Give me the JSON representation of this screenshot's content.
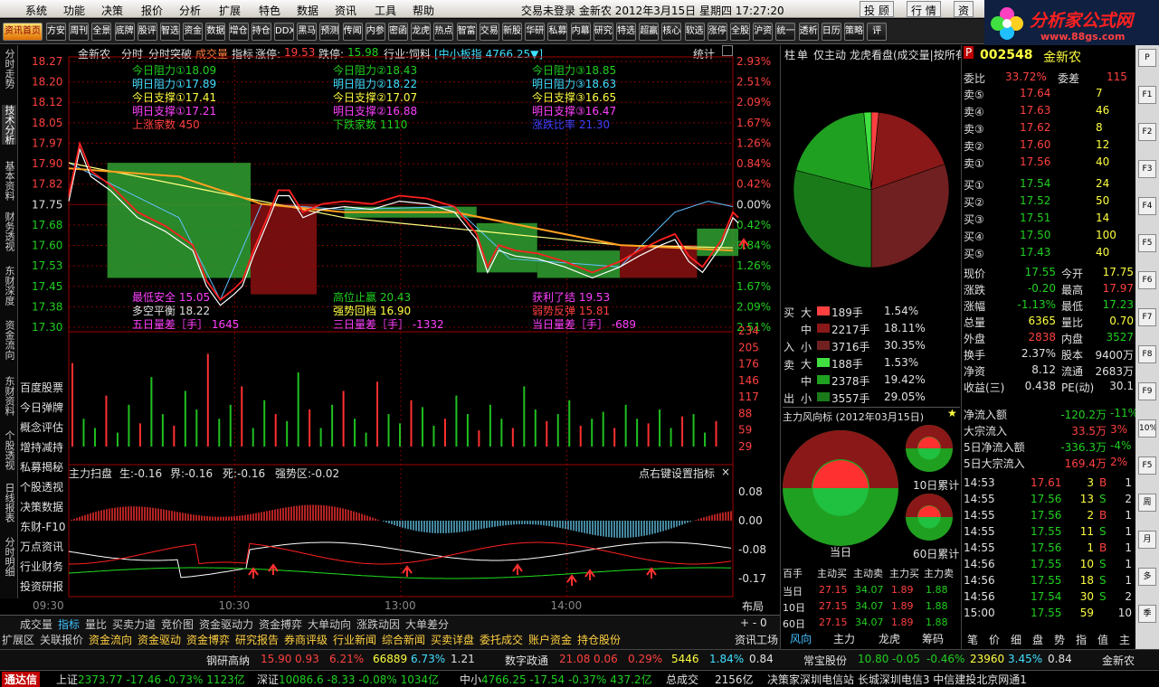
{
  "menu": {
    "items": [
      "系统",
      "功能",
      "决策",
      "报价",
      "分析",
      "扩展",
      "特色",
      "数据",
      "资讯",
      "工具",
      "帮助"
    ],
    "status": "交易未登录",
    "stock_name": "金新农",
    "datetime": "2012年3月15日 星期四 17:27:20",
    "right_buttons": [
      "投 顾",
      "行 情",
      "资"
    ]
  },
  "logo": {
    "title": "分析家公式网",
    "url": "www.88gs.com"
  },
  "toolbar": [
    "资讯首页",
    "方安",
    "周刊",
    "全景",
    "底牌",
    "股评",
    "智选",
    "资金",
    "数据",
    "增仓",
    "持仓",
    "DDX",
    "黑马",
    "预测",
    "传闻",
    "内参",
    "密函",
    "龙虎",
    "热点",
    "智富",
    "交易",
    "新股",
    "华研",
    "私募",
    "内幕",
    "研究",
    "特选",
    "超赢",
    "核心",
    "软选",
    "涨停",
    "全股",
    "沪资",
    "统一",
    "透析",
    "日历",
    "策略",
    "评"
  ],
  "leftnav": [
    {
      "label": "分时走势",
      "active": false
    },
    {
      "label": "技术分析",
      "active": true
    },
    {
      "label": "基本资料",
      "active": false
    },
    {
      "label": "财务透视",
      "active": false
    },
    {
      "label": "东财深度",
      "active": false
    },
    {
      "label": "资金流向",
      "active": false
    },
    {
      "label": "东财资料",
      "active": false
    },
    {
      "label": "个股透视",
      "active": false
    },
    {
      "label": "日线报表",
      "active": false
    },
    {
      "label": "分时明细",
      "active": false
    }
  ],
  "side_menu": [
    "百度股票",
    "今日弹牌",
    "概念评估",
    "增持减持",
    "私募揭秘",
    "个股透视",
    "决策数据",
    "东财-F10",
    "万点资讯",
    "行业财务",
    "投资研报"
  ],
  "header": {
    "name": "金新农",
    "tab1": "分时",
    "tab2": "分时突破",
    "tab3": "成交量",
    "tab4": "指标",
    "zhangting_label": "涨停:",
    "zhangting": "19.53",
    "dieting_label": "跌停:",
    "dieting": "15.98",
    "industry": "行业:饲料",
    "index": "[中小板指 4766.25▼]",
    "stats": "统计"
  },
  "indicators": {
    "col1": [
      "今日阻力①18.09",
      "明日阻力①17.89",
      "今日支撑①17.41",
      "明日支撑①17.21",
      "上涨家数 450"
    ],
    "col2": [
      "今日阻力②18.43",
      "明日阻力②18.22",
      "今日支撑②17.07",
      "明日支撑②16.88",
      "下跌家数 1110"
    ],
    "col3": [
      "今日阻力③18.85",
      "明日阻力③18.63",
      "今日支撑③16.65",
      "明日支撑③16.47",
      "涨跌比率 21.30"
    ],
    "low1": [
      "最低安全 15.05",
      "多空平衡 18.22",
      "五日量差［手］ 1645"
    ],
    "low2": [
      "高位止赢 20.43",
      "强势回档 16.90",
      "三日量差［手］ -1332"
    ],
    "low3": [
      "获利了结 19.53",
      "弱势反弹 15.81",
      "当日量差［手］ -689"
    ]
  },
  "price_axis_left": [
    "18.27",
    "18.20",
    "18.12",
    "18.05",
    "17.97",
    "17.90",
    "17.82",
    "17.75",
    "17.68",
    "17.60",
    "17.53",
    "17.45",
    "17.38",
    "17.30"
  ],
  "price_axis_right": [
    "2.93%",
    "2.51%",
    "2.09%",
    "1.67%",
    "1.26%",
    "0.84%",
    "0.42%",
    "0.00%",
    "0.42%",
    "0.84%",
    "1.26%",
    "1.67%",
    "2.09%",
    "2.51%"
  ],
  "vol_axis": [
    "234",
    "205",
    "176",
    "146",
    "117",
    "88",
    "59",
    "29"
  ],
  "lower_header": {
    "title": "主力扫盘",
    "sheng": "生:-0.16",
    "jie": "界:-0.16",
    "si": "死:-0.16",
    "qiang": "强势区:-0.02",
    "hint": "点右键设置指标"
  },
  "lower_axis": [
    "0.08",
    "0.00",
    "-0.08",
    "-0.17"
  ],
  "time_axis": [
    "09:30",
    "10:30",
    "13:00",
    "14:00"
  ],
  "layout_btn": "布局",
  "chart_data": {
    "type": "line",
    "prev_close": 17.75,
    "price": [
      [
        0,
        17.76
      ],
      [
        4,
        17.95
      ],
      [
        8,
        17.85
      ],
      [
        15,
        17.8
      ],
      [
        25,
        17.7
      ],
      [
        35,
        17.65
      ],
      [
        45,
        17.58
      ],
      [
        50,
        17.45
      ],
      [
        55,
        17.38
      ],
      [
        60,
        17.42
      ],
      [
        63,
        17.45
      ],
      [
        67,
        17.56
      ],
      [
        72,
        17.68
      ],
      [
        76,
        17.78
      ],
      [
        80,
        17.78
      ],
      [
        85,
        17.7
      ],
      [
        92,
        17.73
      ],
      [
        100,
        17.74
      ],
      [
        110,
        17.73
      ],
      [
        120,
        17.76
      ],
      [
        130,
        17.75
      ],
      [
        140,
        17.72
      ],
      [
        148,
        17.62
      ],
      [
        152,
        17.5
      ],
      [
        156,
        17.58
      ],
      [
        162,
        17.56
      ],
      [
        170,
        17.55
      ],
      [
        180,
        17.52
      ],
      [
        190,
        17.48
      ],
      [
        200,
        17.52
      ],
      [
        207,
        17.56
      ],
      [
        215,
        17.6
      ],
      [
        220,
        17.62
      ],
      [
        225,
        17.54
      ],
      [
        230,
        17.5
      ],
      [
        237,
        17.6
      ],
      [
        241,
        17.7
      ],
      [
        243,
        17.68
      ]
    ],
    "avg": [
      [
        0,
        17.88
      ],
      [
        40,
        17.85
      ],
      [
        70,
        17.75
      ],
      [
        100,
        17.72
      ],
      [
        140,
        17.72
      ],
      [
        170,
        17.66
      ],
      [
        200,
        17.6
      ],
      [
        241,
        17.58
      ]
    ],
    "yellow": [
      [
        0,
        17.9
      ],
      [
        50,
        17.8
      ],
      [
        100,
        17.7
      ],
      [
        150,
        17.65
      ],
      [
        200,
        17.6
      ],
      [
        241,
        17.59
      ]
    ],
    "cyan": [
      [
        0,
        17.9
      ],
      [
        40,
        17.7
      ],
      [
        55,
        17.4
      ],
      [
        70,
        17.75
      ],
      [
        100,
        17.73
      ],
      [
        140,
        17.74
      ],
      [
        160,
        17.55
      ],
      [
        200,
        17.52
      ],
      [
        220,
        17.72
      ],
      [
        232,
        17.76
      ],
      [
        241,
        17.74
      ]
    ]
  },
  "flow": {
    "head": [
      "柱",
      "单",
      "仅主动",
      "龙虎看盘(成交量|按所有"
    ],
    "buy": [
      {
        "l": "大",
        "v": "189手",
        "p": "1.54%"
      },
      {
        "l": "中",
        "v": "2217手",
        "p": "18.11%"
      },
      {
        "l": "小",
        "v": "3716手",
        "p": "30.35%"
      }
    ],
    "sell": [
      {
        "l": "大",
        "v": "188手",
        "p": "1.53%"
      },
      {
        "l": "中",
        "v": "2378手",
        "p": "19.42%"
      },
      {
        "l": "小",
        "v": "3557手",
        "p": "29.05%"
      }
    ],
    "buy_side": "买入",
    "sell_side": "卖出",
    "pie": {
      "buy_big": 1.54,
      "buy_mid": 18.11,
      "buy_small": 30.35,
      "sell_big": 1.53,
      "sell_mid": 19.42,
      "sell_small": 29.05
    },
    "wind_title": "主力风向标 (2012年03月15日)",
    "today": "当日",
    "d10": "10日累计",
    "d60": "60日累计",
    "table_head": [
      "百手",
      "主动买",
      "主动卖",
      "主力买",
      "主力卖"
    ],
    "table": [
      [
        "当日",
        "27.15",
        "34.07",
        "1.89",
        "1.88"
      ],
      [
        "10日",
        "27.15",
        "34.07",
        "1.89",
        "1.88"
      ],
      [
        "60日",
        "27.15",
        "34.07",
        "1.89",
        "1.88"
      ]
    ],
    "tabs": [
      "风向",
      "主力",
      "龙虎",
      "筹码"
    ]
  },
  "quote": {
    "code": "002548",
    "name": "金新农",
    "weibi_l": "委比",
    "weibi": "33.72%",
    "weicha_l": "委差",
    "weicha": "115",
    "asks": [
      [
        "卖⑤",
        "17.64",
        "7"
      ],
      [
        "卖④",
        "17.63",
        "46"
      ],
      [
        "卖③",
        "17.62",
        "8"
      ],
      [
        "卖②",
        "17.60",
        "12"
      ],
      [
        "卖①",
        "17.56",
        "40"
      ]
    ],
    "bids": [
      [
        "买①",
        "17.54",
        "24"
      ],
      [
        "买②",
        "17.52",
        "50"
      ],
      [
        "买③",
        "17.51",
        "14"
      ],
      [
        "买④",
        "17.50",
        "100"
      ],
      [
        "买⑤",
        "17.43",
        "40"
      ]
    ],
    "info": [
      [
        "现价",
        "17.55",
        "今开",
        "17.75"
      ],
      [
        "涨跌",
        "-0.20",
        "最高",
        "17.97"
      ],
      [
        "涨幅",
        "-1.13%",
        "最低",
        "17.23"
      ],
      [
        "总量",
        "6365",
        "量比",
        "0.70"
      ],
      [
        "外盘",
        "2838",
        "内盘",
        "3527"
      ],
      [
        "换手",
        "2.37%",
        "股本",
        "9400万"
      ],
      [
        "净资",
        "8.12",
        "流通",
        "2683万"
      ],
      [
        "收益(三)",
        "0.438",
        "PE(动)",
        "30.1"
      ]
    ],
    "flow": [
      [
        "净流入额",
        "-120.2万",
        "-11%"
      ],
      [
        "大宗流入",
        "33.5万",
        "3%"
      ],
      [
        "5日净流入额",
        "-336.3万",
        "-4%"
      ],
      [
        "5日大宗流入",
        "169.4万",
        "2%"
      ]
    ],
    "ticks": [
      [
        "14:53",
        "17.61",
        "3",
        "B",
        "1"
      ],
      [
        "14:55",
        "17.56",
        "13",
        "S",
        "2"
      ],
      [
        "14:55",
        "17.56",
        "2",
        "B",
        "1"
      ],
      [
        "14:55",
        "17.55",
        "11",
        "S",
        "1"
      ],
      [
        "14:55",
        "17.56",
        "1",
        "B",
        "1"
      ],
      [
        "14:56",
        "17.55",
        "10",
        "S",
        "1"
      ],
      [
        "14:56",
        "17.55",
        "18",
        "S",
        "1"
      ],
      [
        "14:56",
        "17.54",
        "30",
        "S",
        "2"
      ],
      [
        "15:00",
        "17.55",
        "59",
        "",
        "10"
      ]
    ],
    "tabs": [
      "笔",
      "价",
      "细",
      "盘",
      "势",
      "指",
      "值",
      "主"
    ]
  },
  "rightbar": [
    "P",
    "F1",
    "F2",
    "F3",
    "F4",
    "F5",
    "F6",
    "F7",
    "F8",
    "F9",
    "10%",
    "F5",
    "周",
    "月",
    "多",
    "季"
  ],
  "bottom_tabs1": [
    "成交量",
    "指标",
    "量比",
    "买卖力道",
    "竞价图",
    "资金驱动力",
    "资金搏弈",
    "大单动向",
    "涨跌动因",
    "大单差分"
  ],
  "bottom_tabs2": [
    "扩展区",
    "关联报价",
    "资金流向",
    "资金驱动",
    "资金博弈",
    "研究报告",
    "券商评级",
    "行业新闻",
    "综合新闻",
    "买卖详盘",
    "委托成交",
    "账户资金",
    "持仓股份"
  ],
  "research_tab": "资讯工场",
  "ticker": [
    {
      "name": "钢研高纳",
      "p": "15.90",
      "c": "0.93",
      "pct": "6.21%",
      "v": "66889",
      "r": "6.73%",
      "x": "1.21"
    },
    {
      "name": "数字政通",
      "p": "21.08",
      "c": "0.06",
      "pct": "0.29%",
      "v": "5446",
      "r": "1.84%",
      "x": "0.84"
    },
    {
      "name": "常宝股份",
      "p": "10.80",
      "c": "-0.05",
      "pct": "-0.46%",
      "v": "23960",
      "r": "3.45%",
      "x": "0.84"
    }
  ],
  "ticker_right": "金新农",
  "status": {
    "brand": "通达信",
    "sh": "上证2373.77 -17.46 -0.73% 1123亿",
    "sz": "深证10086.6 -8.33 -0.08% 1034亿",
    "zx": "中小4766.25 -17.54 -0.37% 437.2亿",
    "total_l": "总成交",
    "total": "2156亿",
    "servers": "决策家深圳电信站  长城深圳电信3  中信建投北京网通1"
  },
  "colors": {
    "up": "#ff3030",
    "down": "#20c020",
    "price_line": "#ffffff",
    "avg_line": "#ffa020",
    "grid": "#800000"
  }
}
